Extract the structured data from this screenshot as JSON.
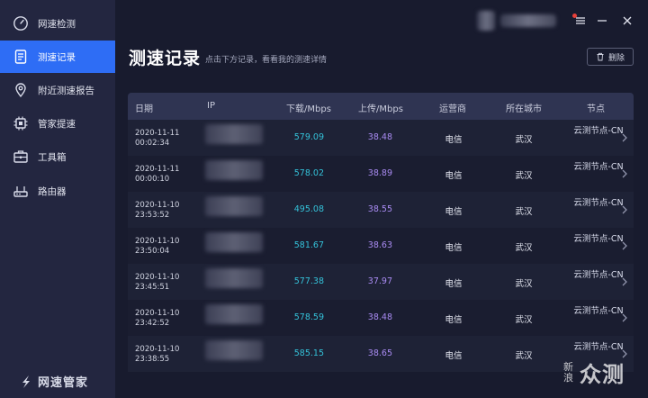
{
  "sidebar": {
    "items": [
      {
        "label": "网速检测",
        "icon": "speedometer-icon"
      },
      {
        "label": "测速记录",
        "icon": "document-icon",
        "active": true
      },
      {
        "label": "附近测速报告",
        "icon": "location-pin-icon"
      },
      {
        "label": "管家提速",
        "icon": "chip-icon"
      },
      {
        "label": "工具箱",
        "icon": "toolbox-icon"
      },
      {
        "label": "路由器",
        "icon": "router-icon"
      }
    ],
    "brand": "网速管家"
  },
  "header": {
    "title": "测速记录",
    "subtitle": "点击下方记录，看看我的测速详情",
    "delete_label": "删除"
  },
  "table": {
    "columns": [
      "日期",
      "IP",
      "下载/Mbps",
      "上传/Mbps",
      "运营商",
      "所在城市",
      "节点"
    ],
    "rows": [
      {
        "date_line1": "2020-11-11",
        "date_line2": "00:02:34",
        "download": "579.09",
        "upload": "38.48",
        "isp": "电信",
        "city": "武汉",
        "node": "云测节点-CN"
      },
      {
        "date_line1": "2020-11-11",
        "date_line2": "00:00:10",
        "download": "578.02",
        "upload": "38.89",
        "isp": "电信",
        "city": "武汉",
        "node": "云测节点-CN"
      },
      {
        "date_line1": "2020-11-10",
        "date_line2": "23:53:52",
        "download": "495.08",
        "upload": "38.55",
        "isp": "电信",
        "city": "武汉",
        "node": "云测节点-CN"
      },
      {
        "date_line1": "2020-11-10",
        "date_line2": "23:50:04",
        "download": "581.67",
        "upload": "38.63",
        "isp": "电信",
        "city": "武汉",
        "node": "云测节点-CN"
      },
      {
        "date_line1": "2020-11-10",
        "date_line2": "23:45:51",
        "download": "577.38",
        "upload": "37.97",
        "isp": "电信",
        "city": "武汉",
        "node": "云测节点-CN"
      },
      {
        "date_line1": "2020-11-10",
        "date_line2": "23:42:52",
        "download": "578.59",
        "upload": "38.48",
        "isp": "电信",
        "city": "武汉",
        "node": "云测节点-CN"
      },
      {
        "date_line1": "2020-11-10",
        "date_line2": "23:38:55",
        "download": "585.15",
        "upload": "38.65",
        "isp": "电信",
        "city": "武汉",
        "node": "云测节点-CN"
      }
    ]
  },
  "watermark": {
    "small": "新浪",
    "big": "众测"
  },
  "colors": {
    "accent": "#2e6df5",
    "download": "#34c2d9",
    "upload": "#a98bf2",
    "notify": "#e8403a"
  }
}
